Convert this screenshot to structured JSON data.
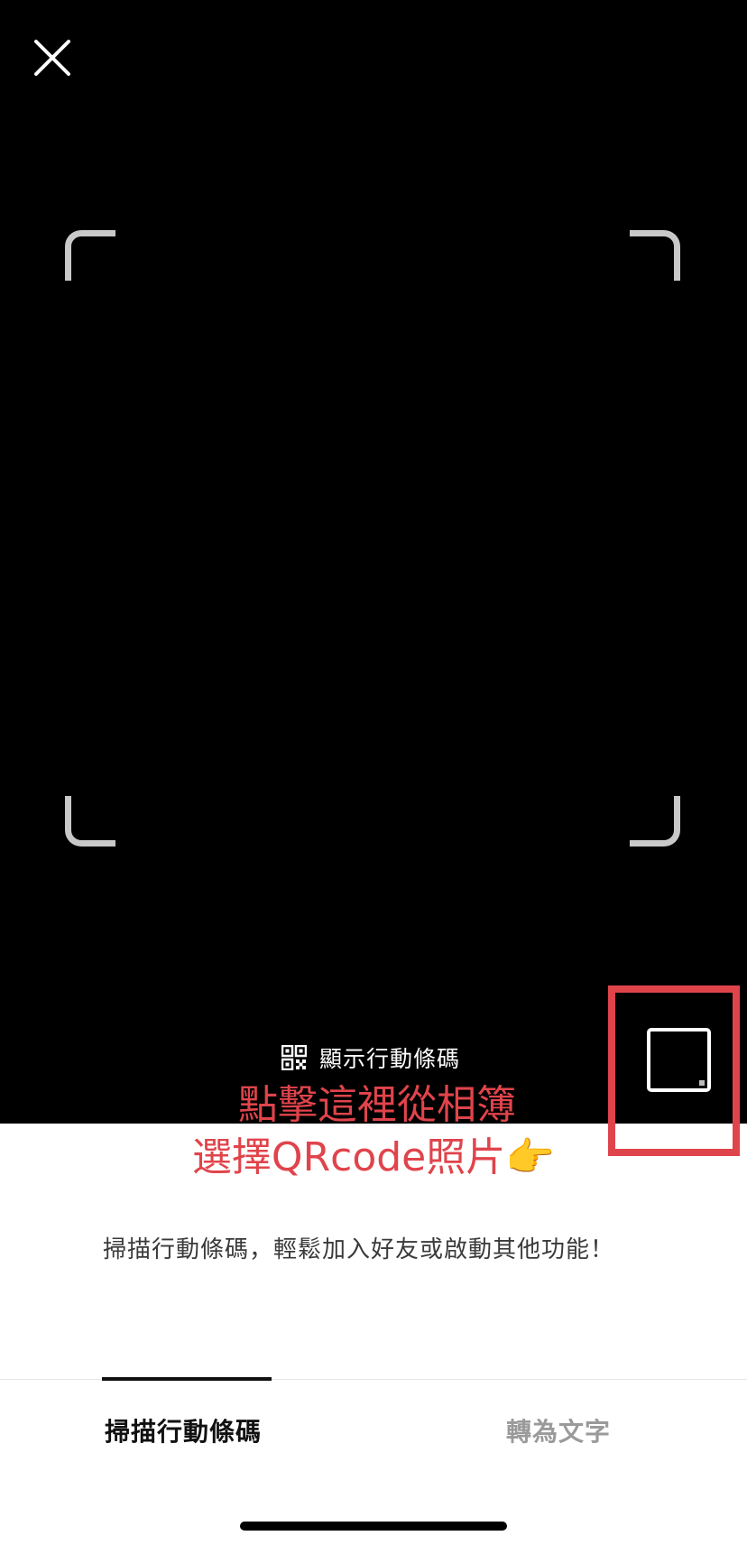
{
  "camera": {
    "close_icon": "close-icon"
  },
  "show_code": {
    "icon": "qr-code-icon",
    "label": "顯示行動條碼"
  },
  "annotation": {
    "line1": "點擊這裡從相簿",
    "line2": "選擇QRcode照片👉",
    "color": "#e0444b"
  },
  "gallery": {
    "icon": "photo-gallery-icon"
  },
  "hint": {
    "text": "掃描行動條碼，輕鬆加入好友或啟動其他功能！"
  },
  "tabs": [
    {
      "label": "掃描行動條碼",
      "active": true
    },
    {
      "label": "轉為文字",
      "active": false
    }
  ]
}
